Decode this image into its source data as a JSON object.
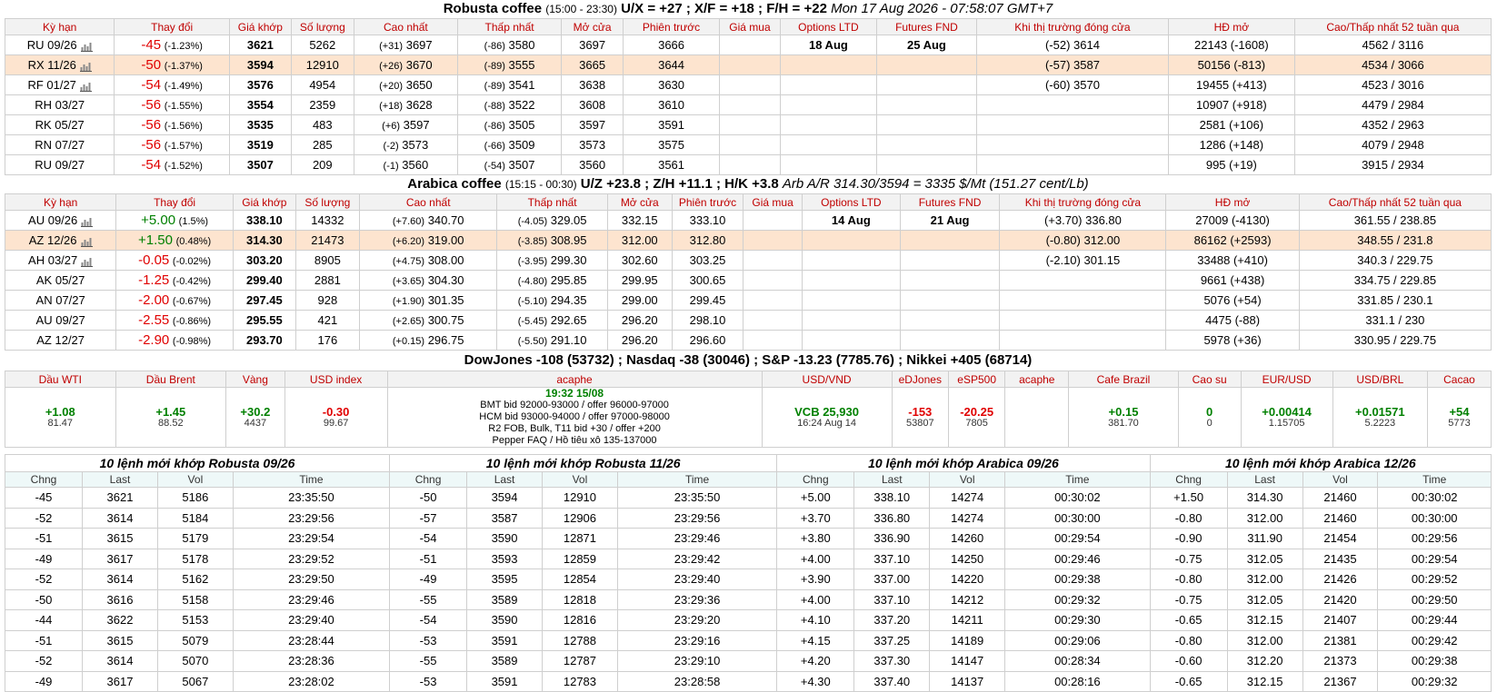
{
  "robusta": {
    "title_name": "Robusta coffee",
    "title_hours": "(15:00 - 23:30)",
    "title_spreads": "U/X = +27 ; X/F = +18 ; F/H = +22",
    "title_time": "Mon 17 Aug 2026 - 07:58:07 GMT+7",
    "headers": [
      "Kỳ hạn",
      "Thay đổi",
      "Giá khớp",
      "Số lượng",
      "Cao nhất",
      "Thấp nhất",
      "Mở cửa",
      "Phiên trước",
      "Giá mua",
      "Options LTD",
      "Futures FND",
      "Khi thị trường đóng cửa",
      "HĐ mở",
      "Cao/Thấp nhất 52 tuần qua"
    ],
    "rows": [
      {
        "term": "RU 09/26",
        "chart": true,
        "chg": "-45",
        "pct": "(-1.23%)",
        "last": "3621",
        "vol": "5262",
        "high_d": "(+31)",
        "high": "3697",
        "low_d": "(-86)",
        "low": "3580",
        "open": "3697",
        "prev": "3666",
        "bid": "",
        "opt": "18 Aug",
        "fnd": "25 Aug",
        "close": "(-52) 3614",
        "oi": "22143 (-1608)",
        "hl52": "4562 / 3116"
      },
      {
        "term": "RX 11/26",
        "chart": true,
        "chg": "-50",
        "pct": "(-1.37%)",
        "last": "3594",
        "vol": "12910",
        "high_d": "(+26)",
        "high": "3670",
        "low_d": "(-89)",
        "low": "3555",
        "open": "3665",
        "prev": "3644",
        "bid": "",
        "opt": "",
        "fnd": "",
        "close": "(-57) 3587",
        "oi": "50156 (-813)",
        "hl52": "4534 / 3066"
      },
      {
        "term": "RF 01/27",
        "chart": true,
        "chg": "-54",
        "pct": "(-1.49%)",
        "last": "3576",
        "vol": "4954",
        "high_d": "(+20)",
        "high": "3650",
        "low_d": "(-89)",
        "low": "3541",
        "open": "3638",
        "prev": "3630",
        "bid": "",
        "opt": "",
        "fnd": "",
        "close": "(-60) 3570",
        "oi": "19455 (+413)",
        "hl52": "4523 / 3016"
      },
      {
        "term": "RH 03/27",
        "chart": false,
        "chg": "-56",
        "pct": "(-1.55%)",
        "last": "3554",
        "vol": "2359",
        "high_d": "(+18)",
        "high": "3628",
        "low_d": "(-88)",
        "low": "3522",
        "open": "3608",
        "prev": "3610",
        "bid": "",
        "opt": "",
        "fnd": "",
        "close": "",
        "oi": "10907 (+918)",
        "hl52": "4479 / 2984"
      },
      {
        "term": "RK 05/27",
        "chart": false,
        "chg": "-56",
        "pct": "(-1.56%)",
        "last": "3535",
        "vol": "483",
        "high_d": "(+6)",
        "high": "3597",
        "low_d": "(-86)",
        "low": "3505",
        "open": "3597",
        "prev": "3591",
        "bid": "",
        "opt": "",
        "fnd": "",
        "close": "",
        "oi": "2581 (+106)",
        "hl52": "4352 / 2963"
      },
      {
        "term": "RN 07/27",
        "chart": false,
        "chg": "-56",
        "pct": "(-1.57%)",
        "last": "3519",
        "vol": "285",
        "high_d": "(-2)",
        "high": "3573",
        "low_d": "(-66)",
        "low": "3509",
        "open": "3573",
        "prev": "3575",
        "bid": "",
        "opt": "",
        "fnd": "",
        "close": "",
        "oi": "1286 (+148)",
        "hl52": "4079 / 2948"
      },
      {
        "term": "RU 09/27",
        "chart": false,
        "chg": "-54",
        "pct": "(-1.52%)",
        "last": "3507",
        "vol": "209",
        "high_d": "(-1)",
        "high": "3560",
        "low_d": "(-54)",
        "low": "3507",
        "open": "3560",
        "prev": "3561",
        "bid": "",
        "opt": "",
        "fnd": "",
        "close": "",
        "oi": "995 (+19)",
        "hl52": "3915 / 2934"
      }
    ]
  },
  "arabica": {
    "title_name": "Arabica coffee",
    "title_hours": "(15:15 - 00:30)",
    "title_spreads": "U/Z +23.8 ; Z/H +11.1 ; H/K +3.8",
    "title_arb": "Arb A/R 314.30/3594 = 3335 $/Mt (151.27 cent/Lb)",
    "headers": [
      "Kỳ hạn",
      "Thay đổi",
      "Giá khớp",
      "Số lượng",
      "Cao nhất",
      "Thấp nhất",
      "Mở cửa",
      "Phiên trước",
      "Giá mua",
      "Options LTD",
      "Futures FND",
      "Khi thị trường đóng cửa",
      "HĐ mở",
      "Cao/Thấp nhất 52 tuần qua"
    ],
    "rows": [
      {
        "term": "AU 09/26",
        "chart": true,
        "chg": "+5.00",
        "pct": "(1.5%)",
        "last": "338.10",
        "vol": "14332",
        "high_d": "(+7.60)",
        "high": "340.70",
        "low_d": "(-4.05)",
        "low": "329.05",
        "open": "332.15",
        "prev": "333.10",
        "bid": "",
        "opt": "14 Aug",
        "fnd": "21 Aug",
        "close": "(+3.70) 336.80",
        "oi": "27009 (-4130)",
        "hl52": "361.55 / 238.85"
      },
      {
        "term": "AZ 12/26",
        "chart": true,
        "chg": "+1.50",
        "pct": "(0.48%)",
        "last": "314.30",
        "vol": "21473",
        "high_d": "(+6.20)",
        "high": "319.00",
        "low_d": "(-3.85)",
        "low": "308.95",
        "open": "312.00",
        "prev": "312.80",
        "bid": "",
        "opt": "",
        "fnd": "",
        "close": "(-0.80) 312.00",
        "oi": "86162 (+2593)",
        "hl52": "348.55 / 231.8"
      },
      {
        "term": "AH 03/27",
        "chart": true,
        "chg": "-0.05",
        "pct": "(-0.02%)",
        "last": "303.20",
        "vol": "8905",
        "high_d": "(+4.75)",
        "high": "308.00",
        "low_d": "(-3.95)",
        "low": "299.30",
        "open": "302.60",
        "prev": "303.25",
        "bid": "",
        "opt": "",
        "fnd": "",
        "close": "(-2.10) 301.15",
        "oi": "33488 (+410)",
        "hl52": "340.3 / 229.75"
      },
      {
        "term": "AK 05/27",
        "chart": false,
        "chg": "-1.25",
        "pct": "(-0.42%)",
        "last": "299.40",
        "vol": "2881",
        "high_d": "(+3.65)",
        "high": "304.30",
        "low_d": "(-4.80)",
        "low": "295.85",
        "open": "299.95",
        "prev": "300.65",
        "bid": "",
        "opt": "",
        "fnd": "",
        "close": "",
        "oi": "9661 (+438)",
        "hl52": "334.75 / 229.85"
      },
      {
        "term": "AN 07/27",
        "chart": false,
        "chg": "-2.00",
        "pct": "(-0.67%)",
        "last": "297.45",
        "vol": "928",
        "high_d": "(+1.90)",
        "high": "301.35",
        "low_d": "(-5.10)",
        "low": "294.35",
        "open": "299.00",
        "prev": "299.45",
        "bid": "",
        "opt": "",
        "fnd": "",
        "close": "",
        "oi": "5076 (+54)",
        "hl52": "331.85 / 230.1"
      },
      {
        "term": "AU 09/27",
        "chart": false,
        "chg": "-2.55",
        "pct": "(-0.86%)",
        "last": "295.55",
        "vol": "421",
        "high_d": "(+2.65)",
        "high": "300.75",
        "low_d": "(-5.45)",
        "low": "292.65",
        "open": "296.20",
        "prev": "298.10",
        "bid": "",
        "opt": "",
        "fnd": "",
        "close": "",
        "oi": "4475 (-88)",
        "hl52": "331.1 / 230"
      },
      {
        "term": "AZ 12/27",
        "chart": false,
        "chg": "-2.90",
        "pct": "(-0.98%)",
        "last": "293.70",
        "vol": "176",
        "high_d": "(+0.15)",
        "high": "296.75",
        "low_d": "(-5.50)",
        "low": "291.10",
        "open": "296.20",
        "prev": "296.60",
        "bid": "",
        "opt": "",
        "fnd": "",
        "close": "",
        "oi": "5978 (+36)",
        "hl52": "330.95 / 229.75"
      }
    ]
  },
  "indices": "DowJones -108 (53732) ; Nasdaq -38 (30046) ; S&P -13.23 (7785.76) ; Nikkei +405 (68714)",
  "misc": {
    "headers": [
      "Dầu WTI",
      "Dầu Brent",
      "Vàng",
      "USD index",
      "acaphe",
      "USD/VND",
      "eDJones",
      "eSP500",
      "acaphe",
      "Cafe Brazil",
      "Cao su",
      "EUR/USD",
      "USD/BRL",
      "Cacao"
    ],
    "wti": {
      "v1": "+1.08",
      "v2": "81.47"
    },
    "brent": {
      "v1": "+1.45",
      "v2": "88.52"
    },
    "gold": {
      "v1": "+30.2",
      "v2": "4437"
    },
    "usdidx": {
      "v1": "-0.30",
      "v2": "99.67"
    },
    "acaphe": {
      "hd": "19:32 15/08",
      "l1": "BMT bid 92000-93000 / offer 96000-97000",
      "l2": "HCM bid 93000-94000 / offer 97000-98000",
      "l3": "R2 FOB, Bulk, T11 bid +30 / offer +200",
      "l4": "Pepper FAQ / Hồ tiêu xô 135-137000"
    },
    "usdvnd": {
      "v1": "VCB 25,930",
      "v2": "16:24 Aug 14"
    },
    "edj": {
      "v1": "-153",
      "v2": "53807"
    },
    "esp": {
      "v1": "-20.25",
      "v2": "7805"
    },
    "acaphe2": "",
    "brazil": {
      "v1": "+0.15",
      "v2": "381.70"
    },
    "rubber": {
      "v1": "0",
      "v2": "0"
    },
    "eurusd": {
      "v1": "+0.00414",
      "v2": "1.15705"
    },
    "usdbrl": {
      "v1": "+0.01571",
      "v2": "5.2223"
    },
    "cacao": {
      "v1": "+54",
      "v2": "5773"
    }
  },
  "trades": {
    "col_headers": [
      "Chng",
      "Last",
      "Vol",
      "Time"
    ],
    "groups": [
      {
        "title": "10 lệnh mới khớp Robusta 09/26",
        "rows": [
          [
            "-45",
            "3621",
            "5186",
            "23:35:50"
          ],
          [
            "-52",
            "3614",
            "5184",
            "23:29:56"
          ],
          [
            "-51",
            "3615",
            "5179",
            "23:29:54"
          ],
          [
            "-49",
            "3617",
            "5178",
            "23:29:52"
          ],
          [
            "-52",
            "3614",
            "5162",
            "23:29:50"
          ],
          [
            "-50",
            "3616",
            "5158",
            "23:29:46"
          ],
          [
            "-44",
            "3622",
            "5153",
            "23:29:40"
          ],
          [
            "-51",
            "3615",
            "5079",
            "23:28:44"
          ],
          [
            "-52",
            "3614",
            "5070",
            "23:28:36"
          ],
          [
            "-49",
            "3617",
            "5067",
            "23:28:02"
          ]
        ]
      },
      {
        "title": "10 lệnh mới khớp Robusta 11/26",
        "rows": [
          [
            "-50",
            "3594",
            "12910",
            "23:35:50"
          ],
          [
            "-57",
            "3587",
            "12906",
            "23:29:56"
          ],
          [
            "-54",
            "3590",
            "12871",
            "23:29:46"
          ],
          [
            "-51",
            "3593",
            "12859",
            "23:29:42"
          ],
          [
            "-49",
            "3595",
            "12854",
            "23:29:40"
          ],
          [
            "-55",
            "3589",
            "12818",
            "23:29:36"
          ],
          [
            "-54",
            "3590",
            "12816",
            "23:29:20"
          ],
          [
            "-53",
            "3591",
            "12788",
            "23:29:16"
          ],
          [
            "-55",
            "3589",
            "12787",
            "23:29:10"
          ],
          [
            "-53",
            "3591",
            "12783",
            "23:28:58"
          ]
        ]
      },
      {
        "title": "10 lệnh mới khớp Arabica 09/26",
        "rows": [
          [
            "+5.00",
            "338.10",
            "14274",
            "00:30:02"
          ],
          [
            "+3.70",
            "336.80",
            "14274",
            "00:30:00"
          ],
          [
            "+3.80",
            "336.90",
            "14260",
            "00:29:54"
          ],
          [
            "+4.00",
            "337.10",
            "14250",
            "00:29:46"
          ],
          [
            "+3.90",
            "337.00",
            "14220",
            "00:29:38"
          ],
          [
            "+4.00",
            "337.10",
            "14212",
            "00:29:32"
          ],
          [
            "+4.10",
            "337.20",
            "14211",
            "00:29:30"
          ],
          [
            "+4.15",
            "337.25",
            "14189",
            "00:29:06"
          ],
          [
            "+4.20",
            "337.30",
            "14147",
            "00:28:34"
          ],
          [
            "+4.30",
            "337.40",
            "14137",
            "00:28:16"
          ]
        ]
      },
      {
        "title": "10 lệnh mới khớp Arabica 12/26",
        "rows": [
          [
            "+1.50",
            "314.30",
            "21460",
            "00:30:02"
          ],
          [
            "-0.80",
            "312.00",
            "21460",
            "00:30:00"
          ],
          [
            "-0.90",
            "311.90",
            "21454",
            "00:29:56"
          ],
          [
            "-0.75",
            "312.05",
            "21435",
            "00:29:54"
          ],
          [
            "-0.80",
            "312.00",
            "21426",
            "00:29:52"
          ],
          [
            "-0.75",
            "312.05",
            "21420",
            "00:29:50"
          ],
          [
            "-0.65",
            "312.15",
            "21407",
            "00:29:44"
          ],
          [
            "-0.80",
            "312.00",
            "21381",
            "00:29:42"
          ],
          [
            "-0.60",
            "312.20",
            "21373",
            "00:29:38"
          ],
          [
            "-0.65",
            "312.15",
            "21367",
            "00:29:32"
          ]
        ]
      }
    ]
  }
}
